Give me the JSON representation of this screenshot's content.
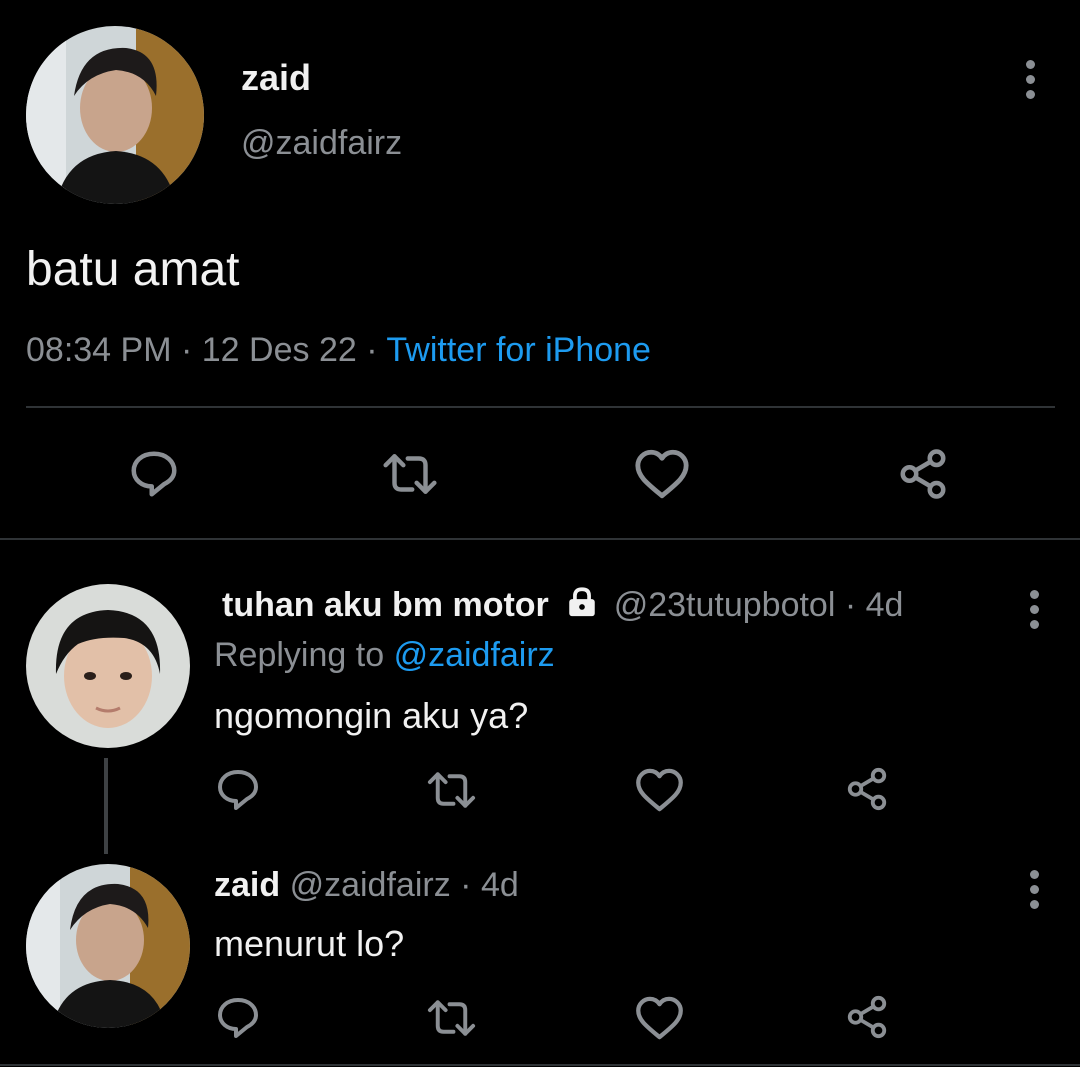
{
  "main_tweet": {
    "display_name": "zaid",
    "handle": "@zaidfairz",
    "text": "batu amat",
    "time": "08:34 PM",
    "sep1": "·",
    "date": "12 Des 22",
    "sep2": "·",
    "source": "Twitter for iPhone"
  },
  "actions": {
    "icons": [
      "reply-icon",
      "retweet-icon",
      "like-icon",
      "share-icon"
    ]
  },
  "replies": [
    {
      "display_name": "tuhan aku bm motor",
      "protected_icon": "lock-icon",
      "handle": "@23tutupbotol",
      "dot": "·",
      "age": "4d",
      "replying_prefix": "Replying to",
      "replying_to": "@zaidfairz",
      "text": "ngomongin aku ya?"
    },
    {
      "display_name": "zaid",
      "handle": "@zaidfairz",
      "dot": "·",
      "age": "4d",
      "text": "menurut lo?"
    }
  ],
  "colors": {
    "background": "#000000",
    "accent": "#1d9bf0",
    "muted": "#8b8f94",
    "divider": "#2f3336"
  }
}
